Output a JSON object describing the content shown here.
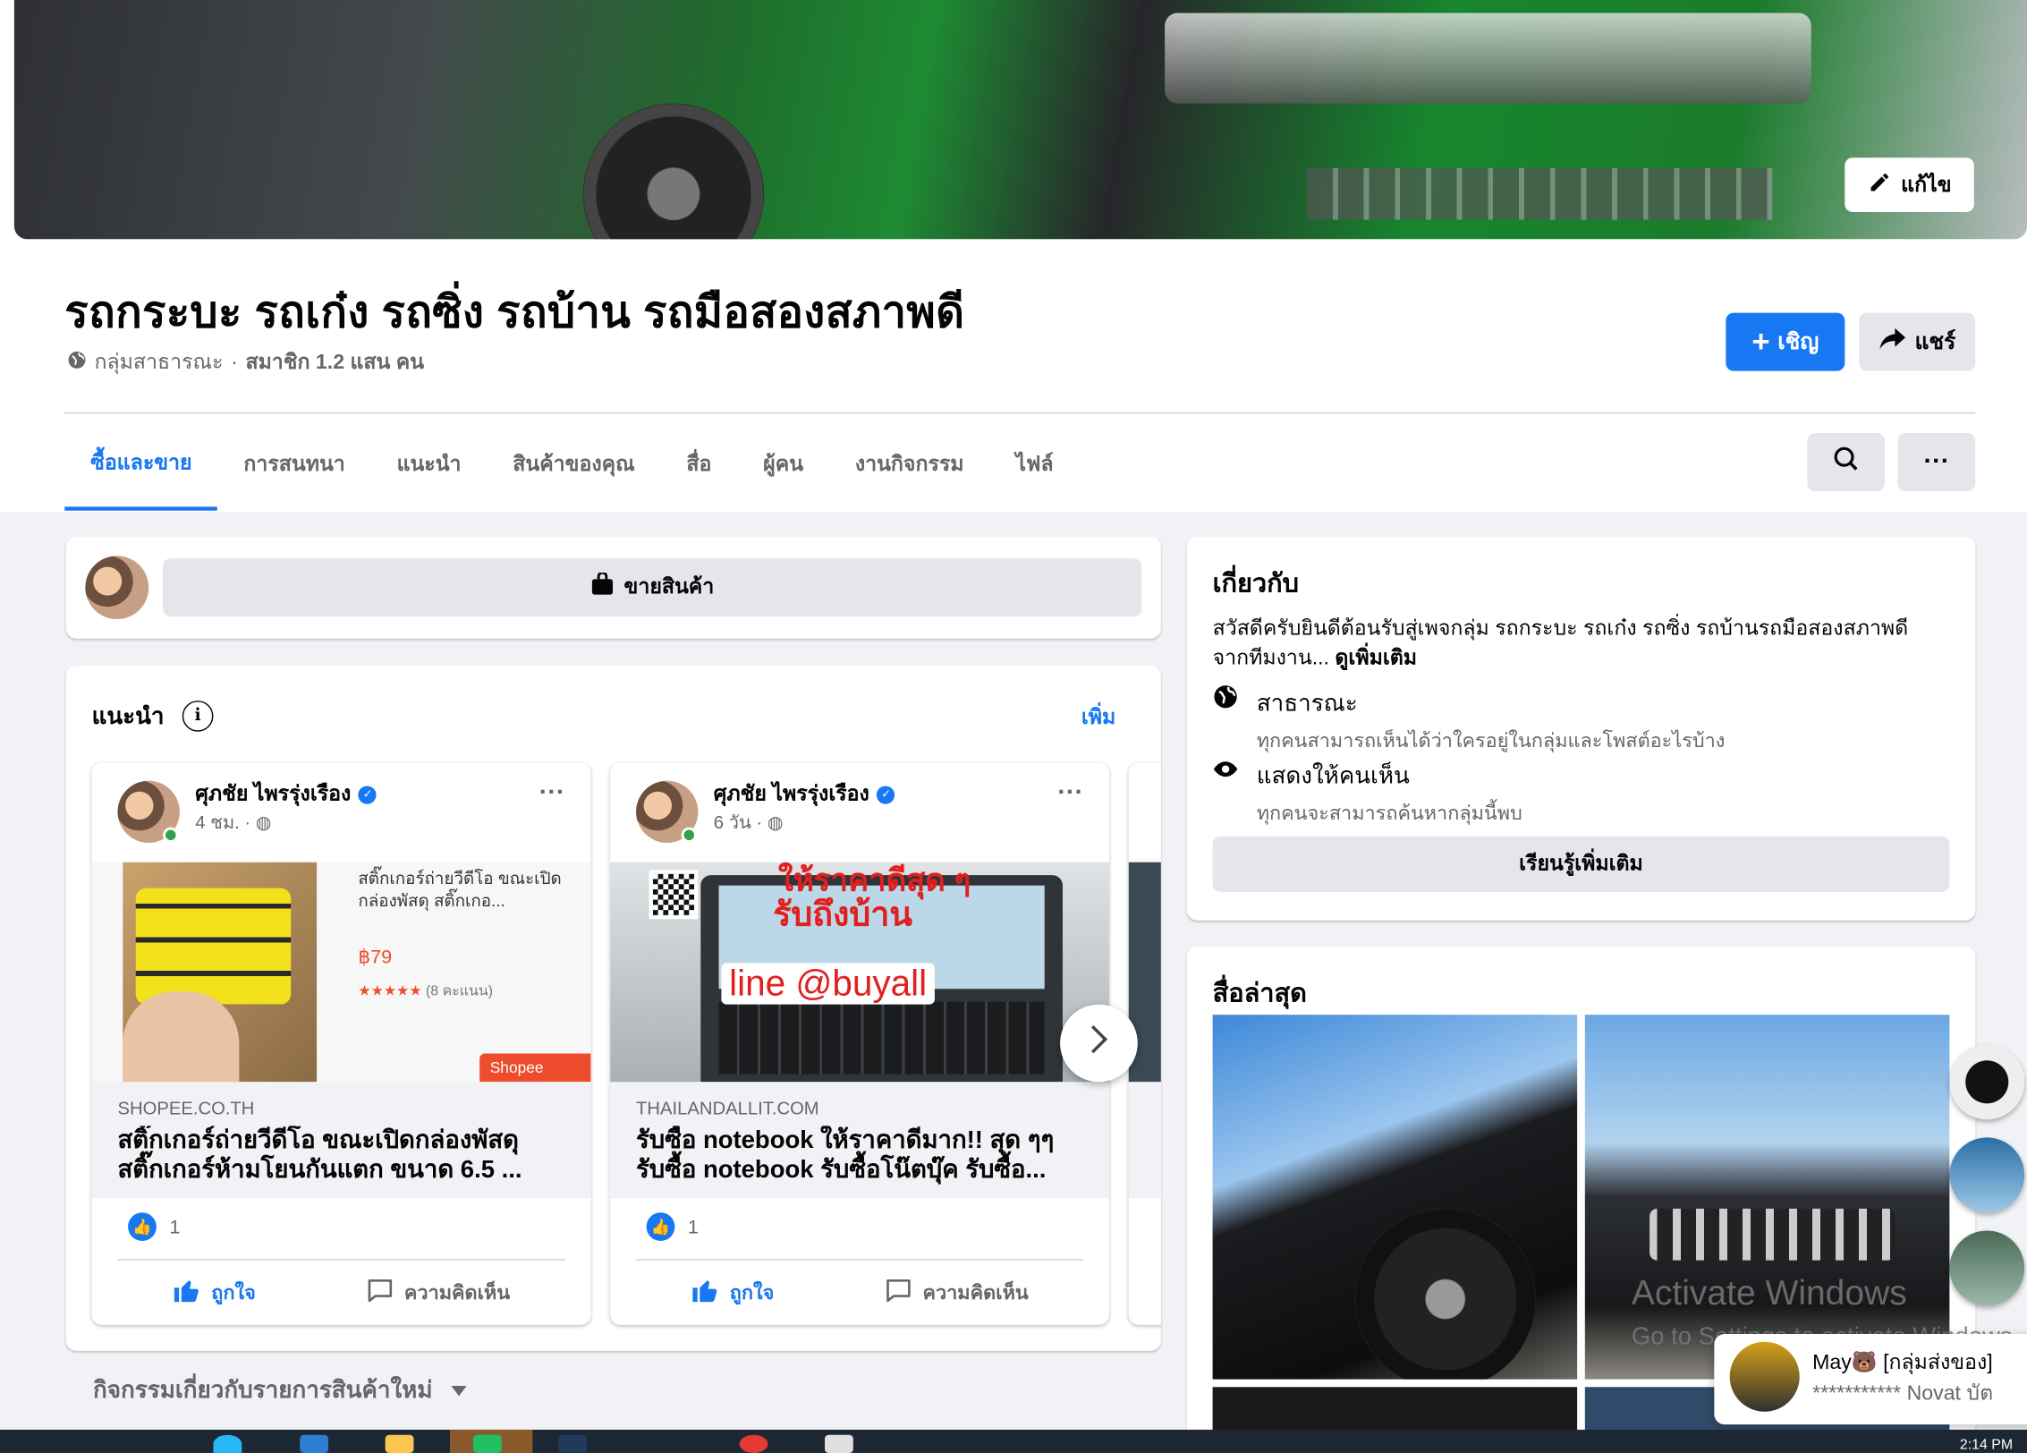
{
  "cover": {
    "edit_label": "แก้ไข"
  },
  "group": {
    "title": "รถกระบะ รถเก๋ง รถซิ่ง รถบ้าน รถมือสองสภาพดี",
    "privacy": "กลุ่มสาธารณะ",
    "separator": "·",
    "members": "สมาชิก 1.2 แสน คน",
    "invite_label": "เชิญ",
    "share_label": "แชร์"
  },
  "tabs": [
    {
      "label": "ซื้อและขาย",
      "active": true
    },
    {
      "label": "การสนทนา"
    },
    {
      "label": "แนะนำ"
    },
    {
      "label": "สินค้าของคุณ"
    },
    {
      "label": "สื่อ"
    },
    {
      "label": "ผู้คน"
    },
    {
      "label": "งานกิจกรรม"
    },
    {
      "label": "ไฟล์"
    }
  ],
  "sell": {
    "button_label": "ขายสินค้า"
  },
  "recommended": {
    "title": "แนะนำ",
    "more_label": "เพิ่ม",
    "posts": [
      {
        "author": "ศุภชัย ไพรรุ่งเรือง",
        "time": "4 ชม. ·",
        "product_title": "สติ๊กเกอร์ถ่ายวีดีโอ ขณะเปิดกล่องพัสดุ สติ๊กเกอ...",
        "price": "฿79",
        "rating_count": "(8 คะแนน)",
        "stars": "★★★★★",
        "shop_badge": "Shopee",
        "domain": "SHOPEE.CO.TH",
        "headline": "สติ๊กเกอร์ถ่ายวีดีโอ ขณะเปิดกล่องพัสดุ สติ๊กเกอร์ห้ามโยนกันแตก ขนาด 6.5 ...",
        "likes": "1",
        "like_label": "ถูกใจ",
        "comment_label": "ความคิดเห็น"
      },
      {
        "author": "ศุภชัย ไพรรุ่งเรือง",
        "time": "6 วัน ·",
        "image_text_top": "ให้ราคาดีสุด ๆ",
        "image_text_mid": "รับถึงบ้าน",
        "image_text_line": "line @buyall",
        "domain": "THAILANDALLIT.COM",
        "headline": "รับซื้อ notebook ให้ราคาดีมาก!! สุด ๆๆ รับซื้อ notebook รับซื้อโน๊ตบุ๊ค รับซื้อ...",
        "likes": "1",
        "like_label": "ถูกใจ",
        "comment_label": "ความคิดเห็น"
      }
    ]
  },
  "activity": {
    "label": "กิจกรรมเกี่ยวกับรายการสินค้าใหม่"
  },
  "about": {
    "title": "เกี่ยวกับ",
    "desc": "สวัสดีครับยินดีต้อนรับสู่เพจกลุ่ม รถกระบะ รถเก๋ง รถซิ่ง รถบ้านรถมือสองสภาพดี จากทีมงาน...",
    "see_more": "ดูเพิ่มเติม",
    "public_title": "สาธารณะ",
    "public_desc": "ทุกคนสามารถเห็นได้ว่าใครอยู่ในกลุ่มและโพสต์อะไรบ้าง",
    "visible_title": "แสดงให้คนเห็น",
    "visible_desc": "ทุกคนจะสามารถค้นหากลุ่มนี้พบ",
    "learn_more": "เรียนรู้เพิ่มเติม"
  },
  "media": {
    "title": "สื่อล่าสุด"
  },
  "watermark": {
    "line1": "Activate Windows",
    "line2": "Go to Settings to activate Windows."
  },
  "chat": {
    "name": "May🐻 [กลุ่มส่งของ]",
    "message": "*********** Novat บัต"
  },
  "taskbar": {
    "clock": "2:14 PM"
  },
  "colors": {
    "accent": "#1877f2",
    "background": "#f0f2f5",
    "online": "#31a24c"
  }
}
